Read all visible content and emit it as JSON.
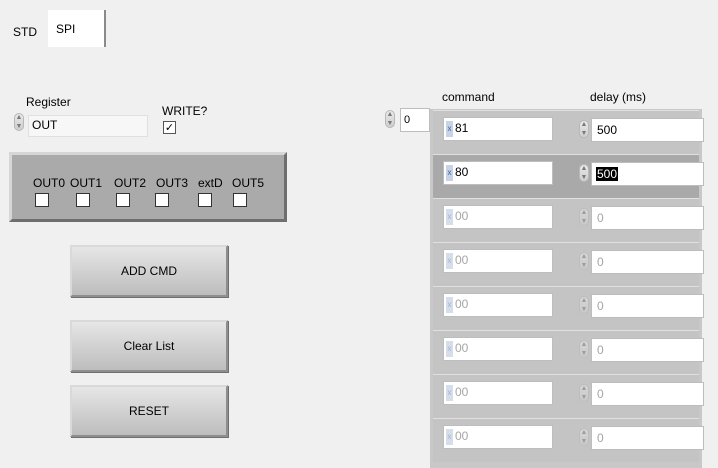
{
  "tabs": [
    {
      "label": "STD"
    },
    {
      "label": "SPI"
    }
  ],
  "register": {
    "label": "Register",
    "value": "OUT"
  },
  "write": {
    "label": "WRITE?",
    "checked": true,
    "check_glyph": "☑"
  },
  "outputs": {
    "labels": [
      "OUT0",
      "OUT1",
      "OUT2",
      "OUT3",
      "extD",
      "OUT5"
    ]
  },
  "buttons": {
    "add_cmd": "ADD CMD",
    "clear_list": "Clear List",
    "reset": "RESET"
  },
  "array_index": "0",
  "columns": {
    "command": "command",
    "delay": "delay (ms)"
  },
  "radix_glyph": "x",
  "rows": [
    {
      "command": "81",
      "delay": "500",
      "active": true
    },
    {
      "command": "80",
      "delay": "500",
      "active": true,
      "selected": true
    },
    {
      "command": "00",
      "delay": "0",
      "active": false
    },
    {
      "command": "00",
      "delay": "0",
      "active": false
    },
    {
      "command": "00",
      "delay": "0",
      "active": false
    },
    {
      "command": "00",
      "delay": "0",
      "active": false
    },
    {
      "command": "00",
      "delay": "0",
      "active": false
    },
    {
      "command": "00",
      "delay": "0",
      "active": false
    }
  ],
  "icons": {
    "spinner": "spinner-arrows-icon",
    "radix": "hex-radix-icon",
    "checkbox": "checkbox-icon"
  }
}
